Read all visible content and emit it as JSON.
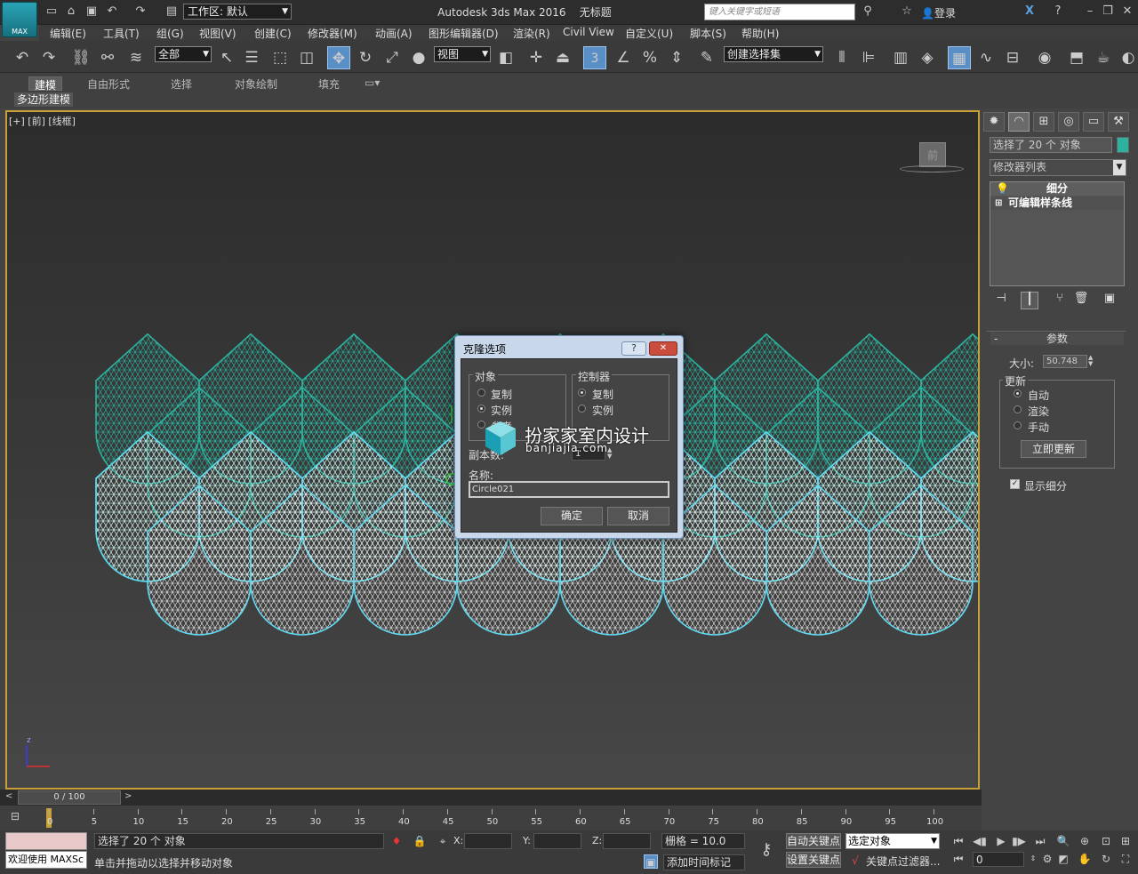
{
  "app": {
    "title": "Autodesk 3ds Max 2016",
    "doc": "无标题",
    "logo_label": "MAX",
    "workspace": "工作区: 默认",
    "search_placeholder": "键入关键字或短语",
    "login": "登录"
  },
  "menu": [
    "编辑(E)",
    "工具(T)",
    "组(G)",
    "视图(V)",
    "创建(C)",
    "修改器(M)",
    "动画(A)",
    "图形编辑器(D)",
    "渲染(R)",
    "Civil View",
    "自定义(U)",
    "脚本(S)",
    "帮助(H)"
  ],
  "toolbar": {
    "filter": "全部",
    "ref_coord": "视图",
    "selection_set": "创建选择集",
    "snap_value": "3"
  },
  "ribbon": {
    "tabs": [
      "建模",
      "自由形式",
      "选择",
      "对象绘制",
      "填充"
    ],
    "sub_tab": "多边形建模"
  },
  "viewport": {
    "label": "[+] [前] [线框]",
    "viewcube_face": "前",
    "axis_z": "z"
  },
  "command_panel": {
    "selection": "选择了 20 个 对象",
    "modifier_list": "修改器列表",
    "stack": [
      "细分",
      "可编辑样条线"
    ],
    "rollout_title": "参数",
    "size_label": "大小:",
    "size_value": "50.748",
    "update_group": "更新",
    "update_options": [
      "自动",
      "渲染",
      "手动"
    ],
    "update_now": "立即更新",
    "show_subdiv": "显示细分",
    "accent": "#2bb3a0"
  },
  "dialog": {
    "title": "克隆选项",
    "object_group": "对象",
    "object_options": [
      "复制",
      "实例",
      "参考"
    ],
    "controller_group": "控制器",
    "controller_options": [
      "复制",
      "实例"
    ],
    "copies_label": "副本数:",
    "copies_value": "1",
    "name_label": "名称:",
    "name_value": "Circle021",
    "ok": "确定",
    "cancel": "取消",
    "help_glyph": "?",
    "close_glyph": "✕"
  },
  "watermark": {
    "line1": "扮家家室内设计",
    "line2": "banjiajia.com"
  },
  "timeline": {
    "frame": "0 / 100",
    "ticks": [
      0,
      5,
      10,
      15,
      20,
      25,
      30,
      35,
      40,
      45,
      50,
      55,
      60,
      65,
      70,
      75,
      80,
      85,
      90,
      95,
      100
    ]
  },
  "status": {
    "welcome": "欢迎使用 MAXSc",
    "selected": "选择了 20 个 对象",
    "prompt": "单击并拖动以选择并移动对象",
    "x_label": "X:",
    "y_label": "Y:",
    "z_label": "Z:",
    "grid": "栅格 = 10.0",
    "add_time_tag": "添加时间标记",
    "auto_key": "自动关键点",
    "set_key": "设置关键点",
    "key_mode": "选定对象",
    "key_filters": "关键点过滤器...",
    "current_frame": "0"
  }
}
